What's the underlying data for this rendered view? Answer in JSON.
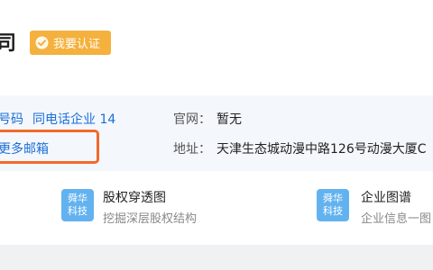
{
  "header": {
    "company_name_fragment": "司",
    "verify_label": "我要认证"
  },
  "info": {
    "phone_more": "号码",
    "same_phone_label": "同电话企业",
    "same_phone_count": "14",
    "website_label": "官网：",
    "website_value": "暂无",
    "email_more": "更多邮箱",
    "address_label": "地址：",
    "address_value": "天津生态城动漫中路126号动漫大厦C"
  },
  "features": [
    {
      "icon_line1": "舜华",
      "icon_line2": "科技",
      "title": "股权穿透图",
      "subtitle": "挖掘深层股权结构"
    },
    {
      "icon_line1": "舜华",
      "icon_line2": "科技",
      "title": "企业图谱",
      "subtitle": "企业信息一图"
    }
  ],
  "colors": {
    "accent_link": "#1a6fd6",
    "badge": "#f5b13d",
    "highlight": "#f2692b",
    "feature_icon": "#63b2f0"
  }
}
